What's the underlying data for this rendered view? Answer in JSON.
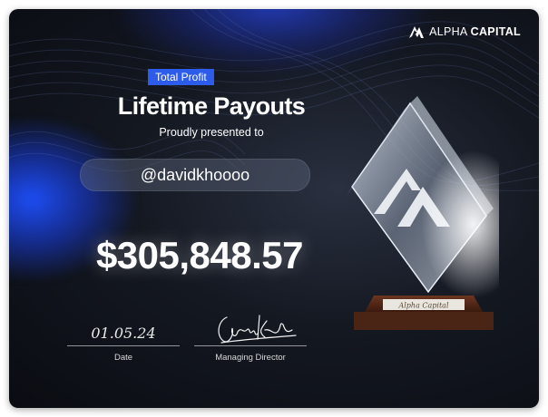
{
  "brand": {
    "name_light": "ALPHA ",
    "name_bold": "CAPITAL",
    "logo": "alpha-logo-icon"
  },
  "badge": {
    "label": "Total Profit",
    "color": "#2d5bea"
  },
  "certificate": {
    "title": "Lifetime Payouts",
    "subtitle": "Proudly presented to",
    "recipient": "@davidkhoooo",
    "amount": "$305,848.57"
  },
  "footer": {
    "date_value": "01.05.24",
    "date_label": "Date",
    "signature_label": "Managing Director",
    "signature_text": "George Kohler"
  },
  "trophy": {
    "plaque_text": "Alpha Capital",
    "icon": "trophy-icon"
  },
  "colors": {
    "background": "#10141c",
    "accent_blue": "#2d5bea",
    "text": "#ffffff"
  }
}
